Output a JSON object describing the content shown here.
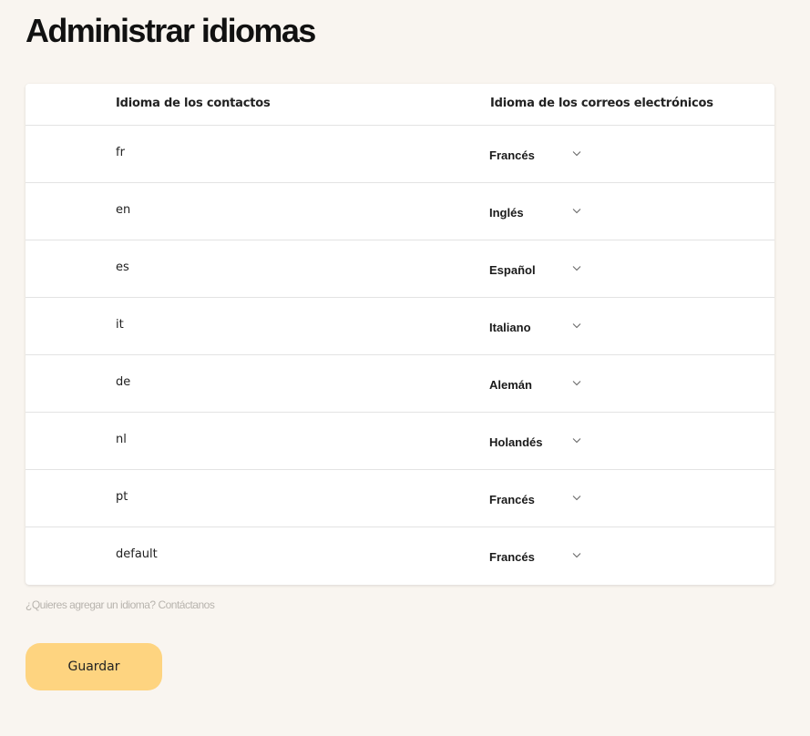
{
  "page": {
    "title": "Administrar idiomas"
  },
  "table": {
    "headers": {
      "contact_language": "Idioma de los contactos",
      "email_language": "Idioma de los correos electrónicos"
    },
    "rows": [
      {
        "code": "fr",
        "language": "Francés"
      },
      {
        "code": "en",
        "language": "Inglés"
      },
      {
        "code": "es",
        "language": "Español"
      },
      {
        "code": "it",
        "language": "Italiano"
      },
      {
        "code": "de",
        "language": "Alemán"
      },
      {
        "code": "nl",
        "language": "Holandés"
      },
      {
        "code": "pt",
        "language": "Francés"
      },
      {
        "code": "default",
        "language": "Francés"
      }
    ]
  },
  "footer": {
    "hint_question": "¿Quieres agregar un idioma?",
    "hint_link": "Contáctanos",
    "save_label": "Guardar"
  },
  "icons": {
    "dropdown": "chevron-down-icon"
  },
  "colors": {
    "background": "#f9f5f0",
    "card": "#ffffff",
    "save_button": "#fed480",
    "hint_text": "#b8b4ae"
  }
}
